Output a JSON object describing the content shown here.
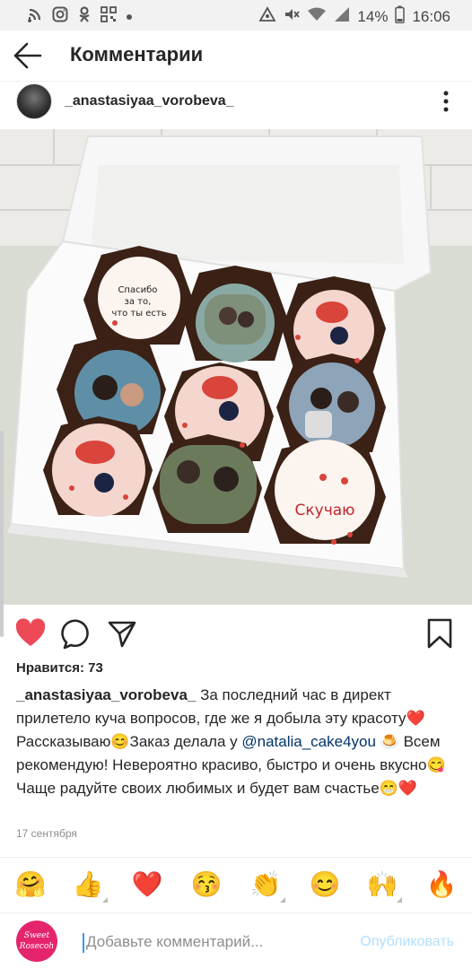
{
  "status_bar": {
    "battery": "14%",
    "time": "16:06",
    "left_icons": [
      "signal-icon",
      "instagram-icon",
      "ok-icon",
      "qr-icon",
      "dot-icon"
    ],
    "right_icons": [
      "alarm-icon",
      "mute-icon",
      "wifi-icon",
      "cellular-icon",
      "battery-icon"
    ]
  },
  "header": {
    "title": "Комментарии",
    "back_icon": "arrow-left-icon"
  },
  "post": {
    "username": "_anastasiyaa_vorobeva_",
    "photo_texts": {
      "cake1": "Спасибо\nза то,\nчто ты есть",
      "cake9": "Скучаю"
    },
    "likes": "Нравится: 73",
    "caption_user": "_anastasiyaa_vorobeva_",
    "caption_part1": " За последний час в директ прилетело куча вопросов, где же я добыла эту красоту",
    "caption_emoji1": "❤️",
    "caption_part2": "Рассказываю",
    "caption_emoji2": "😊",
    "caption_part3": "Заказ делала у ",
    "caption_mention": "@natalia_cake4you",
    "caption_emoji3": " 🍮 ",
    "caption_part4": "Всем рекомендую! Невероятно красиво, быстро и очень вкусно",
    "caption_emoji4": "😋",
    "caption_part5": " Чаще радуйте своих любимых и будет вам счастье",
    "caption_emoji5": "😁",
    "caption_emoji6": "❤️",
    "date": "17 сентября"
  },
  "actions": {
    "icons": [
      "heart-icon",
      "comment-icon",
      "share-icon",
      "bookmark-icon"
    ],
    "liked_color": "#ed4956"
  },
  "emoji_bar": [
    "🤗",
    "👍",
    "❤️",
    "😚",
    "👏",
    "😊",
    "🙌",
    "🔥"
  ],
  "comment": {
    "avatar_text": "Sweet Rosecoh",
    "placeholder": "Добавьте комментарий...",
    "post_label": "Опубликовать"
  },
  "colors": {
    "accent_blue": "#3897f0",
    "post_disabled": "#b2dffc",
    "avatar_pink": "#e4256d"
  }
}
